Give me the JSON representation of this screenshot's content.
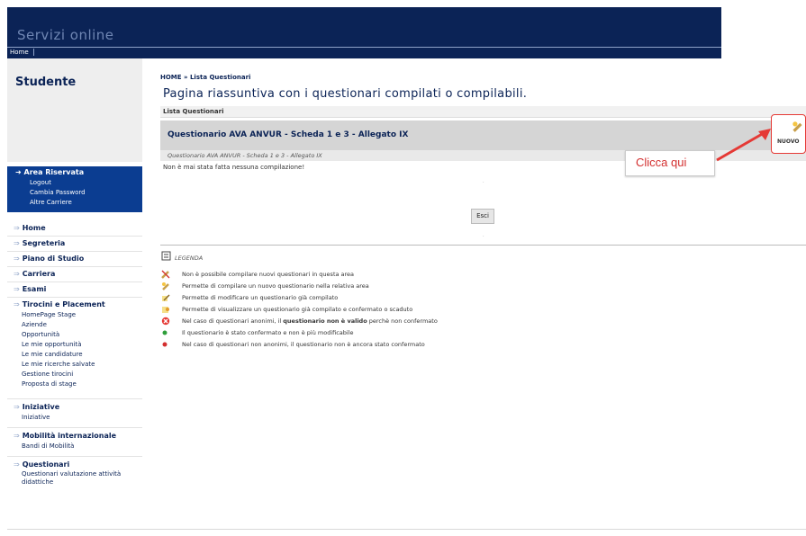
{
  "header": {
    "title": "Servizi online",
    "nav_home": "Home"
  },
  "sidebar": {
    "section_title": "Studente",
    "area_riservata": {
      "label": "Area Riservata",
      "links": [
        "Logout",
        "Cambia Password",
        "Altre Carriere"
      ]
    },
    "menu": [
      {
        "label": "Home"
      },
      {
        "label": "Segreteria"
      },
      {
        "label": "Piano di Studio"
      },
      {
        "label": "Carriera"
      },
      {
        "label": "Esami"
      },
      {
        "label": "Tirocini e Placement",
        "sub": [
          "HomePage Stage",
          "Aziende",
          "Opportunità",
          "Le mie opportunità",
          "Le mie candidature",
          "Le mie ricerche salvate",
          "Gestione tirocini",
          "Proposta di stage"
        ]
      },
      {
        "label": "Iniziative",
        "sub": [
          "Iniziative"
        ]
      },
      {
        "label": "Mobilità internazionale",
        "sub": [
          "Bandi di Mobilità"
        ]
      },
      {
        "label": "Questionari",
        "sub": [
          "Questionari valutazione attività didattiche"
        ]
      }
    ]
  },
  "main": {
    "breadcrumb": "HOME » Lista Questionari",
    "page_title": "Pagina riassuntiva con i questionari compilati o compilabili.",
    "list_header": "Lista Questionari",
    "questionnaire_name": "Questionario AVA ANVUR - Scheda 1 e 3 - Allegato IX",
    "questionnaire_subtitle": "Questionario AVA ANVUR - Scheda 1 e 3 - Allegato IX",
    "no_compilation": "Non è mai stata fatta nessuna compilazione!",
    "exit_button": "Esci",
    "new_button": "NUOVO",
    "callout": "Clicca qui",
    "legend_title": "LEGENDA",
    "legend": [
      {
        "icon": "pencil-forbidden-icon",
        "text_before": "Non è possibile compilare nuovi questionari in questa area",
        "bold": "",
        "text_after": ""
      },
      {
        "icon": "pencil-new-icon",
        "text_before": "Permette di compilare un nuovo questionario nella relativa area",
        "bold": "",
        "text_after": ""
      },
      {
        "icon": "pencil-edit-icon",
        "text_before": "Permette di modificare un questionario già compilato",
        "bold": "",
        "text_after": ""
      },
      {
        "icon": "view-icon",
        "text_before": "Permette di visualizzare un questionario già compilato e confermato o scaduto",
        "bold": "",
        "text_after": ""
      },
      {
        "icon": "invalid-icon",
        "text_before": "Nel caso di questionari anonimi, il ",
        "bold": "questionario non è valido",
        "text_after": " perchè non confermato"
      },
      {
        "icon": "green-dot-icon",
        "text_before": "Il questionario è stato confermato e non è più modificabile",
        "bold": "",
        "text_after": ""
      },
      {
        "icon": "red-dot-icon",
        "text_before": "Nel caso di questionari non anonimi, il questionario non è ancora stato confermato",
        "bold": "",
        "text_after": ""
      }
    ]
  },
  "colors": {
    "header_bg": "#0b2356",
    "area_bg": "#0b3d91",
    "accent_red": "#e53935"
  }
}
